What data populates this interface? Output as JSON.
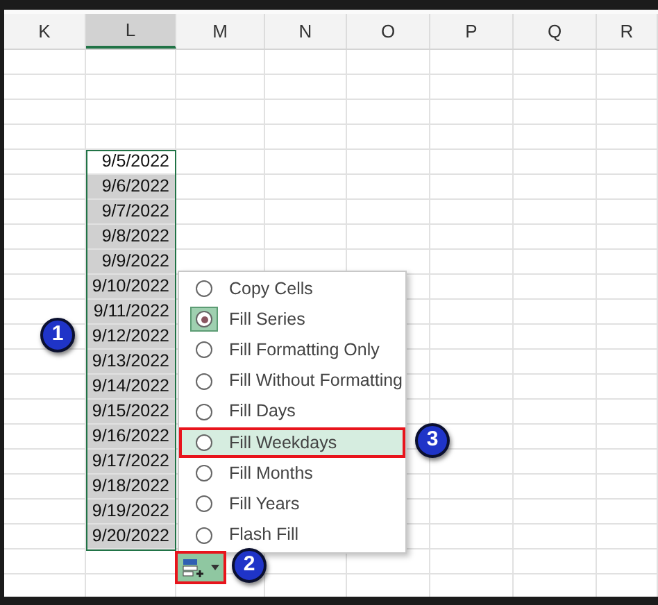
{
  "columns": [
    {
      "label": "K",
      "selected": false
    },
    {
      "label": "L",
      "selected": true
    },
    {
      "label": "M",
      "selected": false
    },
    {
      "label": "N",
      "selected": false
    },
    {
      "label": "O",
      "selected": false
    },
    {
      "label": "P",
      "selected": false
    },
    {
      "label": "Q",
      "selected": false
    },
    {
      "label": "R",
      "selected": false
    }
  ],
  "filled_cells": [
    {
      "text": "9/5/2022",
      "active": true
    },
    {
      "text": "9/6/2022",
      "active": false
    },
    {
      "text": "9/7/2022",
      "active": false
    },
    {
      "text": "9/8/2022",
      "active": false
    },
    {
      "text": "9/9/2022",
      "active": false
    },
    {
      "text": "9/10/2022",
      "active": false
    },
    {
      "text": "9/11/2022",
      "active": false
    },
    {
      "text": "9/12/2022",
      "active": false
    },
    {
      "text": "9/13/2022",
      "active": false
    },
    {
      "text": "9/14/2022",
      "active": false
    },
    {
      "text": "9/15/2022",
      "active": false
    },
    {
      "text": "9/16/2022",
      "active": false
    },
    {
      "text": "9/17/2022",
      "active": false
    },
    {
      "text": "9/18/2022",
      "active": false
    },
    {
      "text": "9/19/2022",
      "active": false
    },
    {
      "text": "9/20/2022",
      "active": false
    }
  ],
  "autofill_menu": {
    "items": [
      {
        "label": "Copy Cells",
        "selected": false,
        "highlighted": false
      },
      {
        "label": "Fill Series",
        "selected": true,
        "highlighted": false
      },
      {
        "label": "Fill Formatting Only",
        "selected": false,
        "highlighted": false
      },
      {
        "label": "Fill Without Formatting",
        "selected": false,
        "highlighted": false
      },
      {
        "label": "Fill Days",
        "selected": false,
        "highlighted": false
      },
      {
        "label": "Fill Weekdays",
        "selected": false,
        "highlighted": true
      },
      {
        "label": "Fill Months",
        "selected": false,
        "highlighted": false
      },
      {
        "label": "Fill Years",
        "selected": false,
        "highlighted": false
      },
      {
        "label": "Flash Fill",
        "selected": false,
        "highlighted": false
      }
    ]
  },
  "options_button": {
    "highlighted": true
  },
  "callouts": [
    "1",
    "2",
    "3"
  ]
}
